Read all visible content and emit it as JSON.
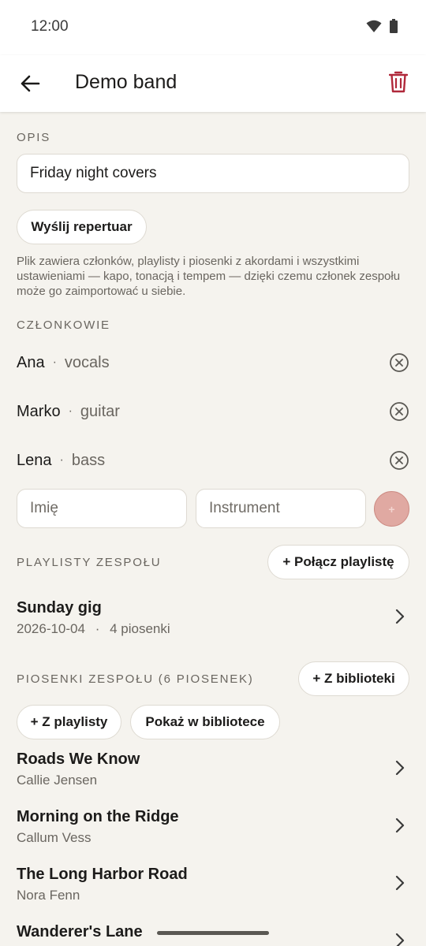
{
  "status": {
    "time": "12:00"
  },
  "header": {
    "title": "Demo band"
  },
  "description": {
    "label": "OPIS",
    "value": "Friday night covers",
    "send_button": "Wyślij repertuar",
    "help": "Plik zawiera członków, playlisty i piosenki z akordami i wszystkimi ustawieniami — kapo, tonacją i tempem — dzięki czemu członek zespołu może go zaimportować u siebie."
  },
  "members": {
    "label": "CZŁONKOWIE",
    "items": [
      {
        "name": "Ana",
        "instrument": "vocals"
      },
      {
        "name": "Marko",
        "instrument": "guitar"
      },
      {
        "name": "Lena",
        "instrument": "bass"
      }
    ],
    "separator": "·",
    "name_placeholder": "Imię",
    "instrument_placeholder": "Instrument",
    "add_symbol": "+"
  },
  "playlists": {
    "label": "PLAYLISTY ZESPOŁU",
    "link_button": "+ Połącz playlistę",
    "items": [
      {
        "title": "Sunday gig",
        "date": "2026-10-04",
        "sep": "·",
        "count": "4 piosenki"
      }
    ]
  },
  "songs": {
    "label": "PIOSENKI ZESPOŁU (6 PIOSENEK)",
    "from_library_button": "+ Z biblioteki",
    "from_playlist_button": "+ Z playlisty",
    "show_in_library_button": "Pokaż w bibliotece",
    "items": [
      {
        "title": "Roads We Know",
        "artist": "Callie Jensen"
      },
      {
        "title": "Morning on the Ridge",
        "artist": "Callum Vess"
      },
      {
        "title": "The Long Harbor Road",
        "artist": "Nora Fenn"
      },
      {
        "title": "Wanderer's Lane",
        "artist": ""
      }
    ]
  },
  "colors": {
    "accent": "#b0283a",
    "background": "#f5f3ee",
    "muted_text": "#6a6660"
  }
}
